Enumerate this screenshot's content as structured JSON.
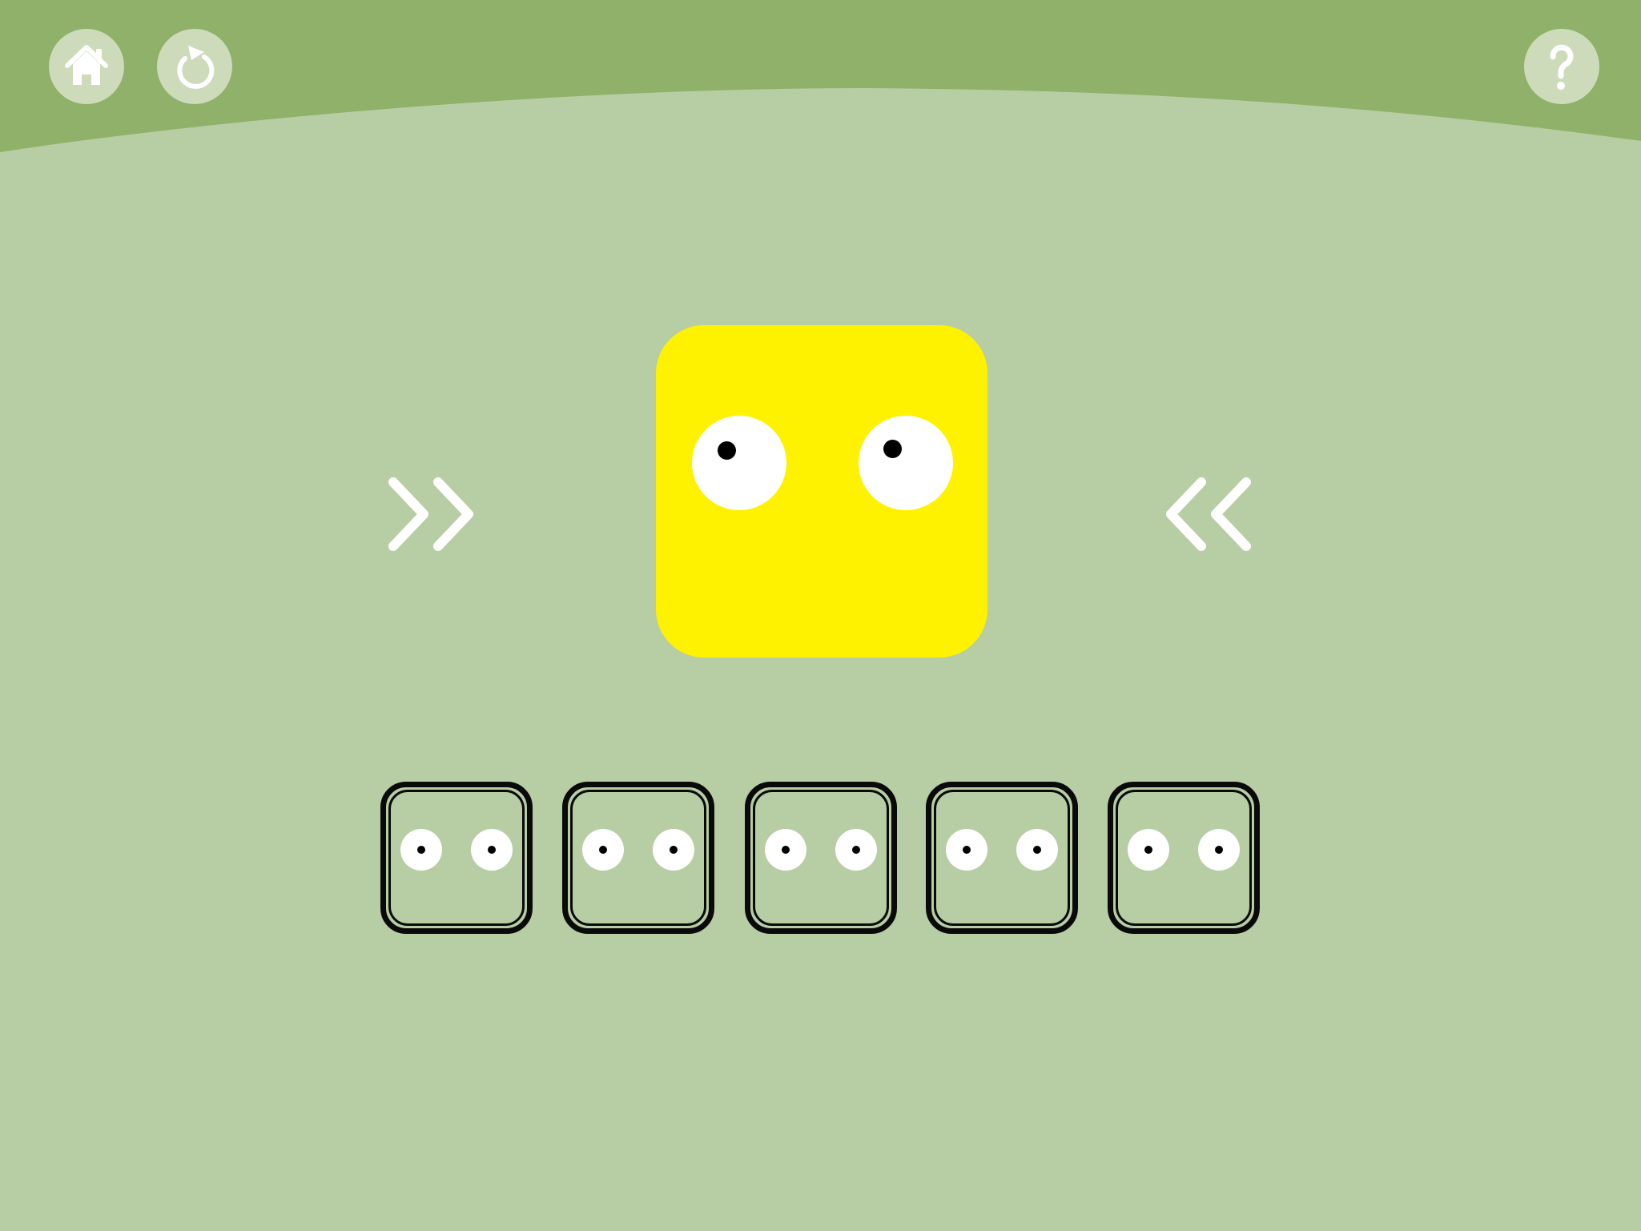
{
  "colors": {
    "background": "#b7cda3",
    "header": "#8fb169",
    "button_bg": "#cddbba",
    "face": "#fff200",
    "eye": "#ffffff",
    "pupil": "#000000",
    "slot_outline": "#0a0a0a"
  },
  "toolbar": {
    "home_icon": "home-icon",
    "restart_icon": "restart-icon",
    "help_icon": "question-mark-icon"
  },
  "character": {
    "shape": "rounded-square",
    "color": "#fff200",
    "eyes": 2
  },
  "hint_arrows": {
    "left_side": "double-chevron-right",
    "right_side": "double-chevron-left"
  },
  "answer_slots": {
    "count": 5,
    "slot_icon": "face-outline-with-eyes"
  }
}
